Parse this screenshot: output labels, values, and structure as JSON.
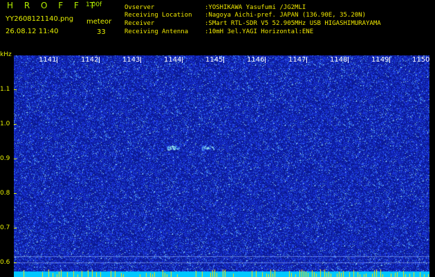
{
  "header": {
    "logo": "H R O F F T",
    "version": "1.00f",
    "filename": "YY2608121140.png",
    "datetime": "26.08.12 11:40",
    "meteor_label": "meteor",
    "meteor_count": "33"
  },
  "info": [
    {
      "label": "Ovserver",
      "value": ":YOSHIKAWA Yasufumi /JG2MLI"
    },
    {
      "label": "Receiving Location",
      "value": ":Nagoya Aichi-pref. JAPAN (136.90E, 35.20N)"
    },
    {
      "label": "Receiver",
      "value": ":SMart RTL-SDR V5 52.905MHz USB HIGASHIMURAYAMA"
    },
    {
      "label": "Receiving Antenna",
      "value": ":10mH 3el.YAGI Horizontal:ENE"
    }
  ],
  "y_axis": {
    "unit": "kHz",
    "ticks": [
      "1.1",
      "1.0",
      "0.9",
      "0.8",
      "0.7",
      "0.6"
    ]
  },
  "x_axis": {
    "ticks": [
      "1141",
      "1142",
      "1143",
      "1144",
      "1145",
      "1146",
      "1147",
      "1148",
      "1149",
      "1150"
    ]
  },
  "colors": {
    "background": "#0a1890",
    "noise": "#1e3cf0",
    "bright": "#50a0ff",
    "hot": "#a0f0e0",
    "bottom_band": "#00c8ff",
    "spikes": "#ffe000",
    "labels": "#e6f000"
  }
}
